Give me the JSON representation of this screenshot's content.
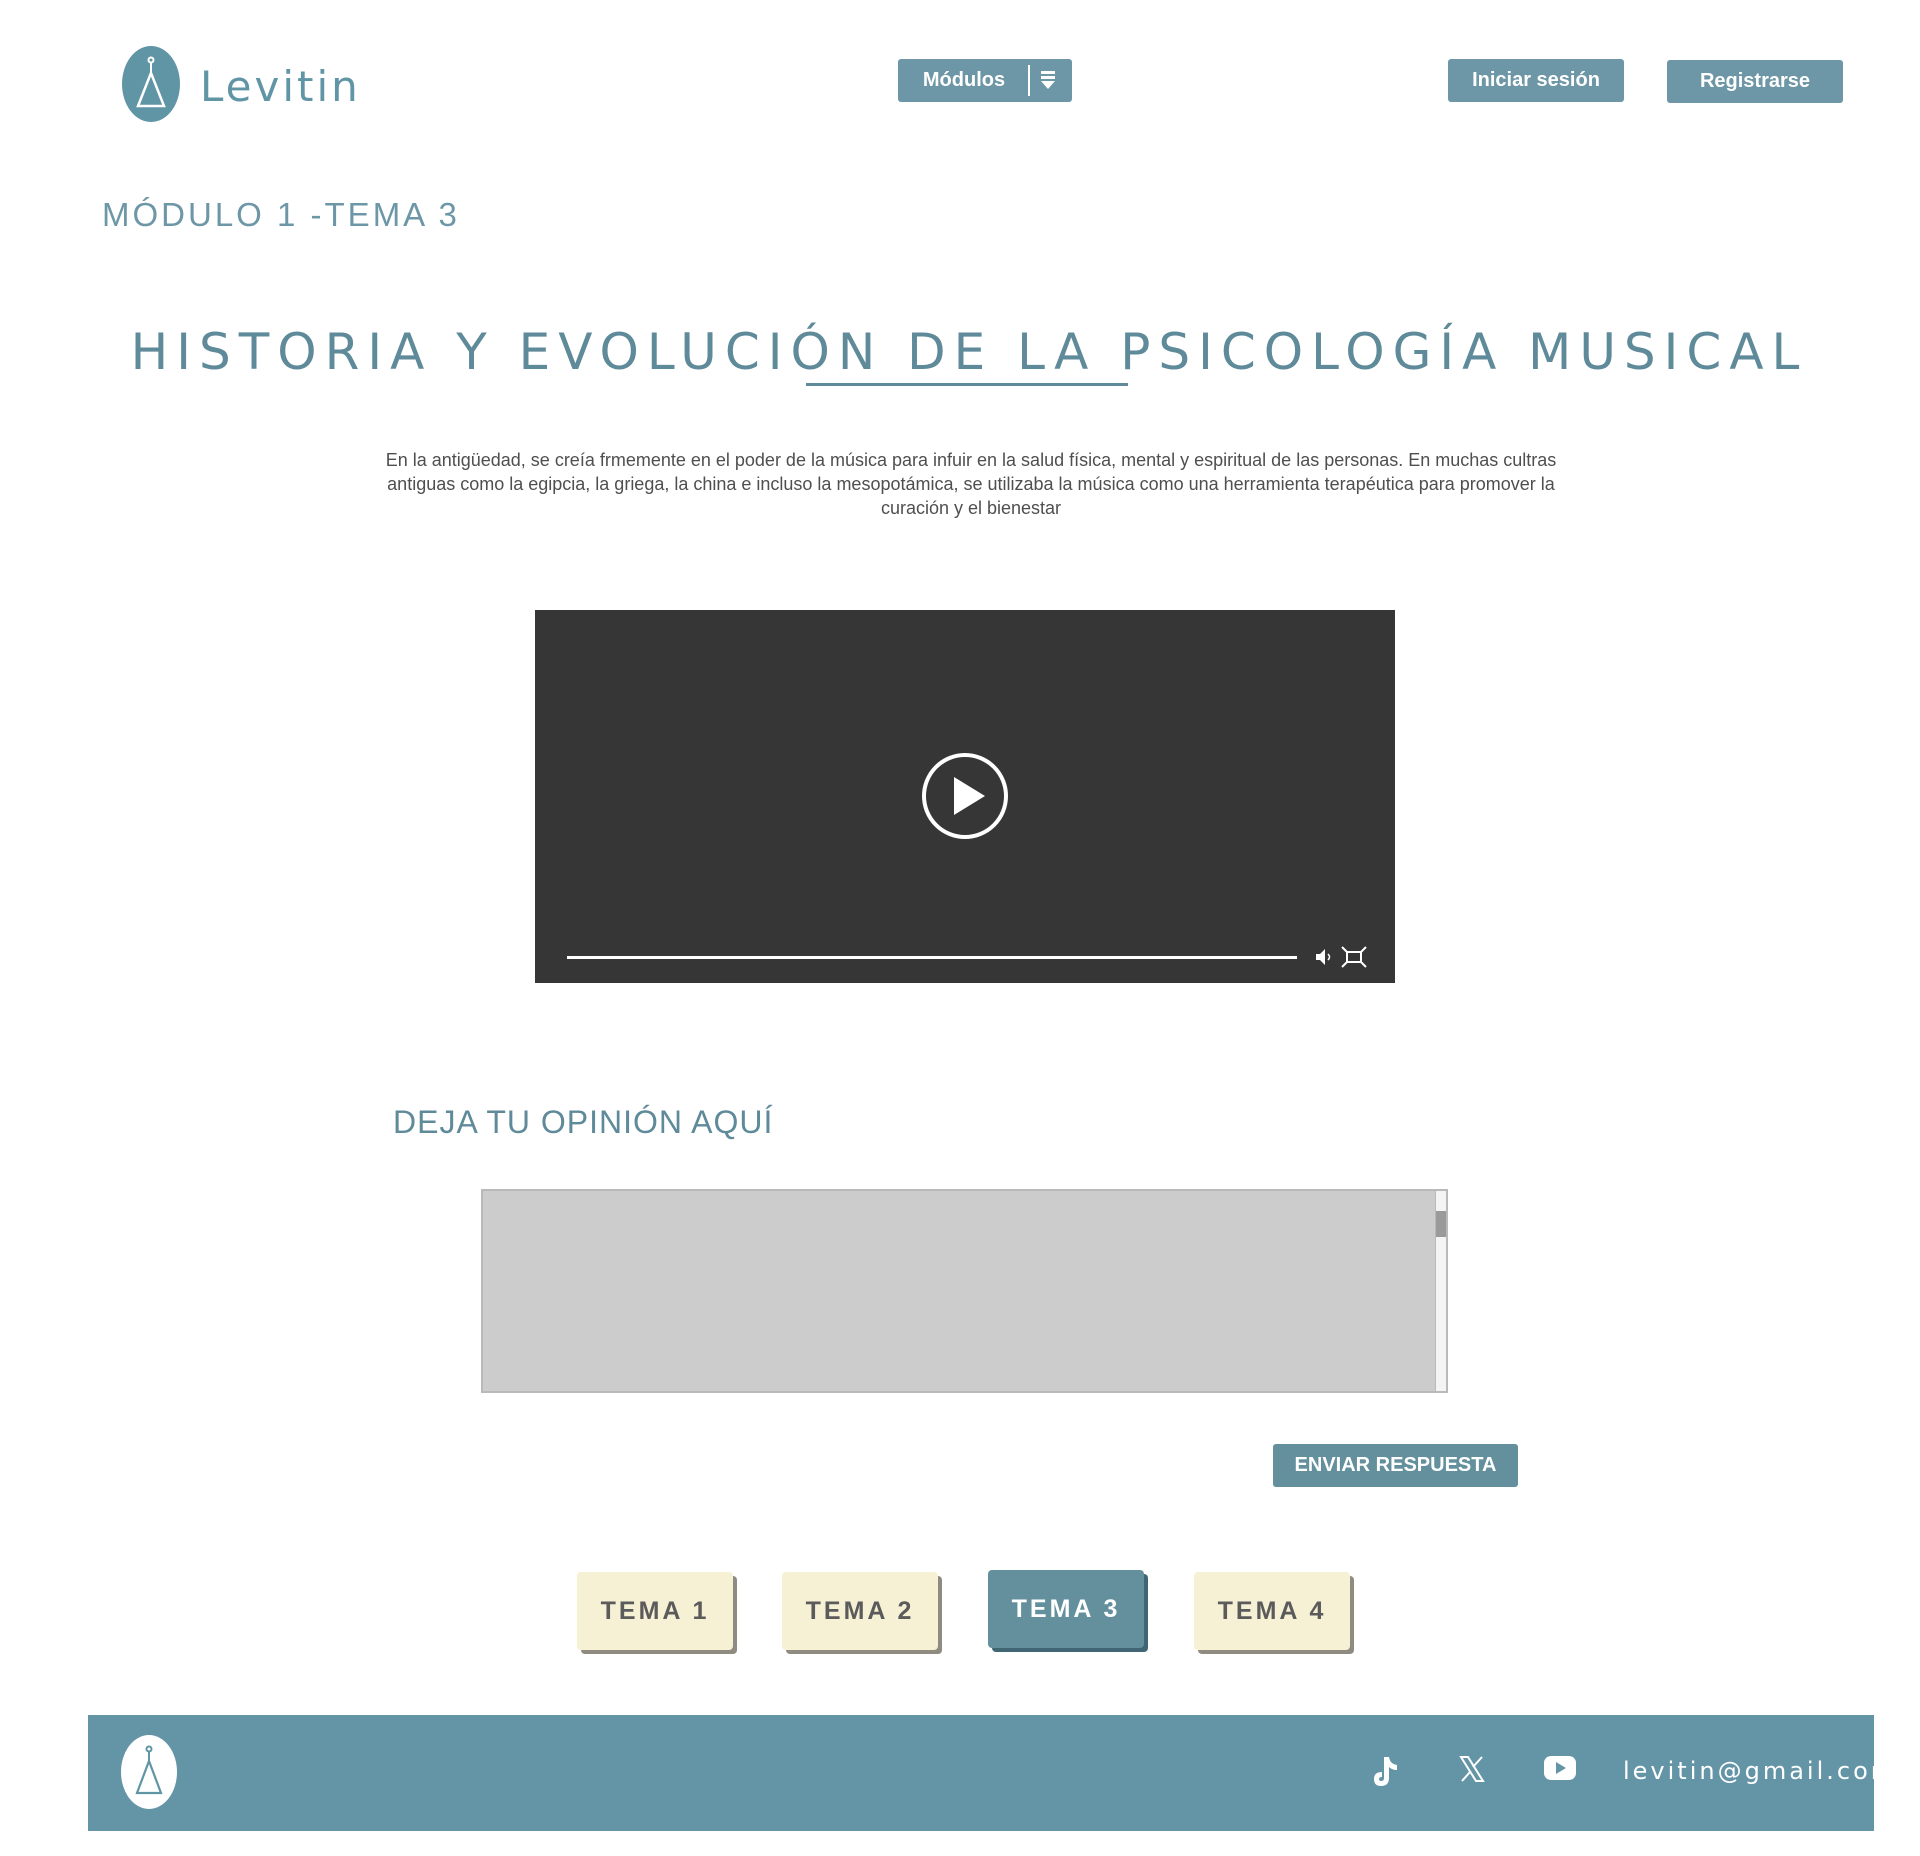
{
  "header": {
    "brand": "Levitin",
    "modulos_label": "Módulos",
    "login_label": "Iniciar sesión",
    "register_label": "Registrarse"
  },
  "page": {
    "module_title": "MÓDULO 1 -TEMA 3",
    "main_title": "HISTORIA Y EVOLUCIÓN DE LA PSICOLOGÍA MUSICAL",
    "intro": "En la antigüedad, se creía frmemente en el poder de la música para infuir en la salud física, mental y espiritual de las personas. En muchas cultras antiguas como la egipcia, la griega, la china e incluso la mesopotámica, se utilizaba la música como una herramienta terapéutica para promover la curación y el bienestar"
  },
  "video": {
    "icons": [
      "play-icon",
      "volume-icon",
      "fullscreen-icon"
    ]
  },
  "feedback": {
    "title": "DEJA TU OPINIÓN AQUÍ",
    "textarea_value": "",
    "send_label": "ENVIAR RESPUESTA"
  },
  "tabs": [
    {
      "label": "TEMA 1",
      "active": false
    },
    {
      "label": "TEMA 2",
      "active": false
    },
    {
      "label": "TEMA 3",
      "active": true
    },
    {
      "label": "TEMA 4",
      "active": false
    }
  ],
  "footer": {
    "email": "levitin@gmail.com",
    "social_icons": [
      "tiktok-icon",
      "x-icon",
      "youtube-icon"
    ]
  },
  "colors": {
    "accent": "#6095a6",
    "tab_inactive": "#f6f0d4",
    "tab_active": "#63909c",
    "video_bg": "#363636"
  }
}
